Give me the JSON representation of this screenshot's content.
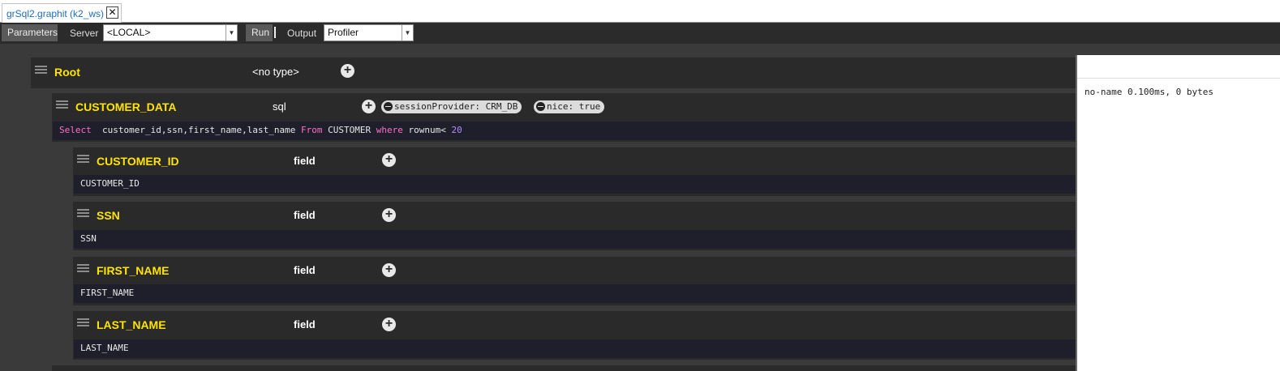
{
  "tab": {
    "title": "grSql2.graphit (k2_ws)",
    "close_glyph": "✕"
  },
  "toolbar": {
    "parameters_label": "Parameters",
    "server_label": "Server",
    "server_value": "<LOCAL>",
    "run_label": "Run",
    "output_label": "Output",
    "output_value": "Profiler"
  },
  "tree": {
    "root": {
      "name": "Root",
      "type": "<no type>"
    },
    "customer_data": {
      "name": "CUSTOMER_DATA",
      "type": "sql",
      "attributes": [
        "sessionProvider: CRM_DB",
        "nice: true"
      ],
      "sql": {
        "kw_select": "Select",
        "columns": "  customer_id,ssn,first_name,last_name ",
        "kw_from": "From",
        "table": " CUSTOMER ",
        "kw_where": "where",
        "condition": " rownum< ",
        "limit": "20"
      }
    },
    "fields": [
      {
        "name": "CUSTOMER_ID",
        "type": "field",
        "value": "CUSTOMER_ID"
      },
      {
        "name": "SSN",
        "type": "field",
        "value": "SSN"
      },
      {
        "name": "FIRST_NAME",
        "type": "field",
        "value": "FIRST_NAME"
      },
      {
        "name": "LAST_NAME",
        "type": "field",
        "value": "LAST_NAME"
      }
    ]
  },
  "output": {
    "line": "no-name 0.100ms, 0 bytes"
  },
  "icons": {
    "plus": "plus-circle-icon",
    "minus": "minus-circle-icon",
    "handle": "drag-handle-icon"
  },
  "colors": {
    "node_name": "#ffe400",
    "keyword": "#ff6fc8",
    "number": "#b48cff",
    "tab_text": "#1e6fb8"
  }
}
